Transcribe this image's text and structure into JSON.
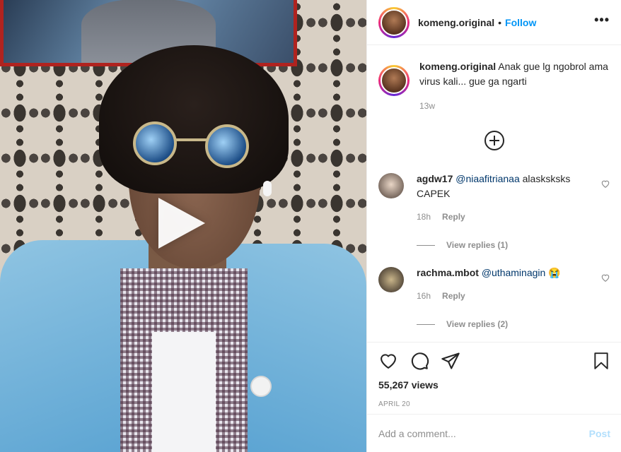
{
  "post": {
    "username": "komeng.original",
    "separator": "•",
    "follow_label": "Follow",
    "more_label": "•••"
  },
  "caption": {
    "username": "komeng.original",
    "text": "Anak gue lg ngobrol ama virus kali... gue ga ngarti",
    "time": "13w"
  },
  "comments": [
    {
      "username": "agdw17",
      "mention": "@niaafitrianaa",
      "text": "alasksksks CAPEK",
      "time": "18h",
      "reply_label": "Reply",
      "view_replies": "View replies (1)"
    },
    {
      "username": "rachma.mbot",
      "mention": "@uthaminagin",
      "text": "😭",
      "time": "16h",
      "reply_label": "Reply",
      "view_replies": "View replies (2)"
    }
  ],
  "stats": {
    "views": "55,267 views",
    "date": "APRIL 20"
  },
  "composer": {
    "placeholder": "Add a comment...",
    "post_label": "Post"
  },
  "colors": {
    "accent": "#0095f6",
    "post_disabled": "#b2dffc",
    "muted": "#8e8e8e"
  },
  "icons": [
    "play-icon",
    "more-icon",
    "plus-circle-icon",
    "heart-icon",
    "comment-icon",
    "share-icon",
    "bookmark-icon"
  ]
}
